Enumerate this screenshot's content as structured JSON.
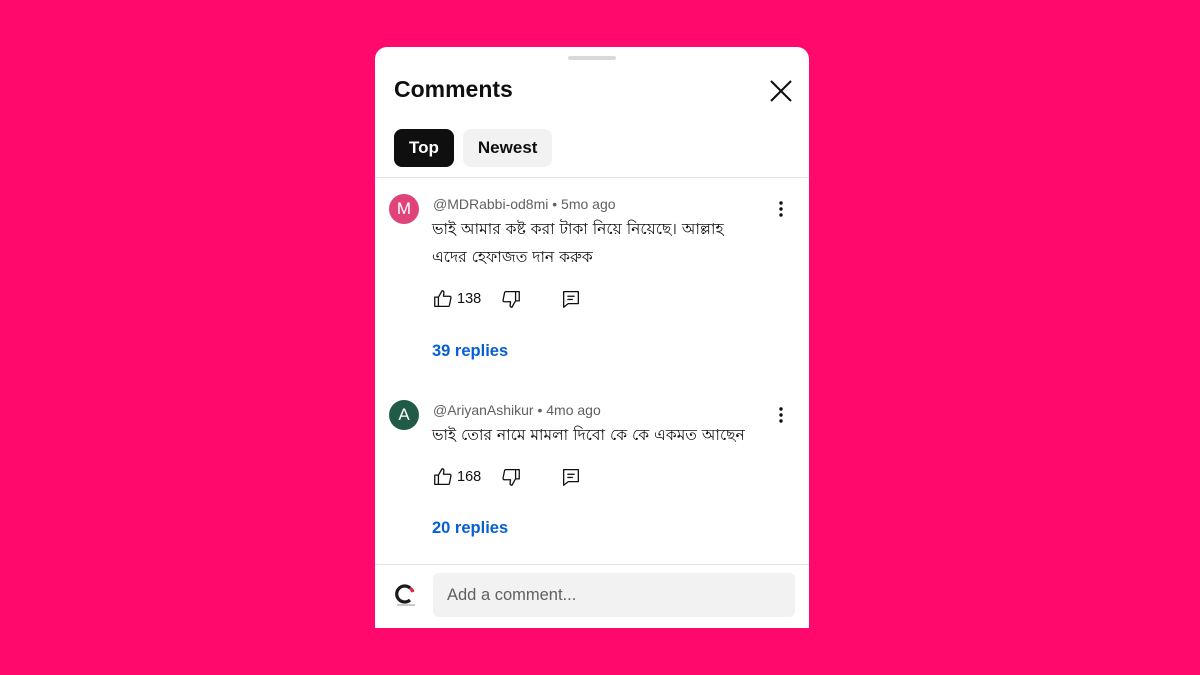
{
  "theme": {
    "background": "#ff0a6c",
    "link": "#065fd4",
    "chip_active": "#0f0f0f",
    "chip_inactive": "#f2f2f2"
  },
  "header": {
    "title": "Comments",
    "close_icon": "close-icon"
  },
  "tabs": [
    {
      "label": "Top",
      "active": true
    },
    {
      "label": "Newest",
      "active": false
    }
  ],
  "comments": [
    {
      "avatar_letter": "M",
      "avatar_color": "#e0437a",
      "handle": "@MDRabbi-od8mi",
      "separator": "•",
      "time": "5mo ago",
      "lines": [
        "ভাই আমার কষ্ট করা টাকা  নিয়ে নিয়েছে। আল্লাহ",
        "এদের হেফাজত দান করুক"
      ],
      "likes": "138",
      "replies": "39 replies"
    },
    {
      "avatar_letter": "A",
      "avatar_color": "#1f5b47",
      "handle": "@AriyanAshikur",
      "separator": "•",
      "time": "4mo ago",
      "lines": [
        "ভাই তোর নামে মামলা দিবো কে কে একমত আছেন"
      ],
      "likes": "168",
      "replies": "20 replies"
    }
  ],
  "footer": {
    "placeholder": "Add a comment..."
  }
}
